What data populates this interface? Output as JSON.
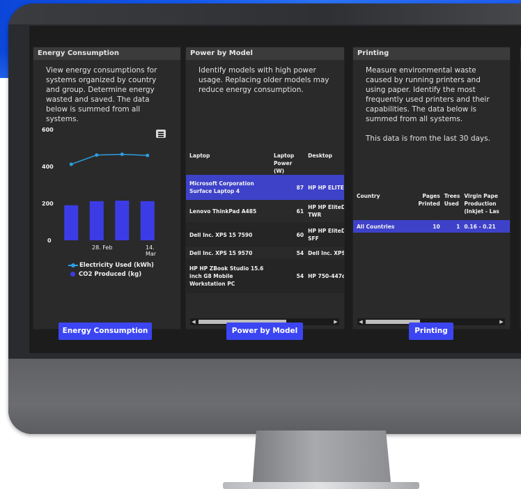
{
  "panels": {
    "energy": {
      "title": "Energy Consumption",
      "description": "View energy consumptions for systems organized by country and group. Determine energy wasted and saved. The data below is summed from all systems.",
      "button": "Energy Consumption"
    },
    "power": {
      "title": "Power by Model",
      "description": "Identify models with high power usage. Replacing older models may reduce energy consumption.",
      "button": "Power by Model",
      "columns": [
        "Laptop",
        "Laptop Power (W)",
        "Desktop"
      ],
      "rows": [
        {
          "laptop": "Microsoft Corporation Surface Laptop 4",
          "power": "87",
          "desktop": "HP HP ELITE"
        },
        {
          "laptop": "Lenovo ThinkPad A485",
          "power": "61",
          "desktop": "HP HP EliteD TWR"
        },
        {
          "laptop": "Dell Inc. XPS 15 7590",
          "power": "60",
          "desktop": "HP HP EliteD SFF"
        },
        {
          "laptop": "Dell Inc. XPS 15 9570",
          "power": "54",
          "desktop": "Dell Inc. XPS"
        },
        {
          "laptop": "HP HP ZBook Studio 15.6 inch G8 Mobile Workstation PC",
          "power": "54",
          "desktop": "HP 750-447c"
        }
      ]
    },
    "printing": {
      "title": "Printing",
      "description": "Measure environmental waste caused by running printers and using paper. Identify the most frequently used printers and their capabilities. The data below is summed from all systems.",
      "note": "This data is from the last 30 days.",
      "button": "Printing",
      "columns": [
        "Country",
        "Pages Printed",
        "Trees Used",
        "Virgin Pape Production (Inkjet - Las"
      ],
      "rows": [
        {
          "country": "All Countries",
          "pages": "10",
          "trees": "1",
          "virgin": "0.16 - 0.21"
        }
      ]
    }
  },
  "chart_data": {
    "type": "bar",
    "categories": [
      "",
      "28. Feb",
      "",
      "14. Mar"
    ],
    "series": [
      {
        "name": "CO2 Produced (kg)",
        "type": "bar",
        "values": [
          190,
          212,
          215,
          212
        ]
      },
      {
        "name": "Electricity Used (kWh)",
        "type": "line",
        "values": [
          412,
          462,
          466,
          460
        ]
      }
    ],
    "ylim": [
      0,
      600
    ],
    "yticks": [
      0,
      200,
      400,
      600
    ],
    "legend_position": "bottom",
    "colors": {
      "bar": "#3c3ce6",
      "line": "#2e9ee0"
    }
  },
  "colors": {
    "accent": "#3c45f2",
    "selected_row": "#3e42c9"
  }
}
